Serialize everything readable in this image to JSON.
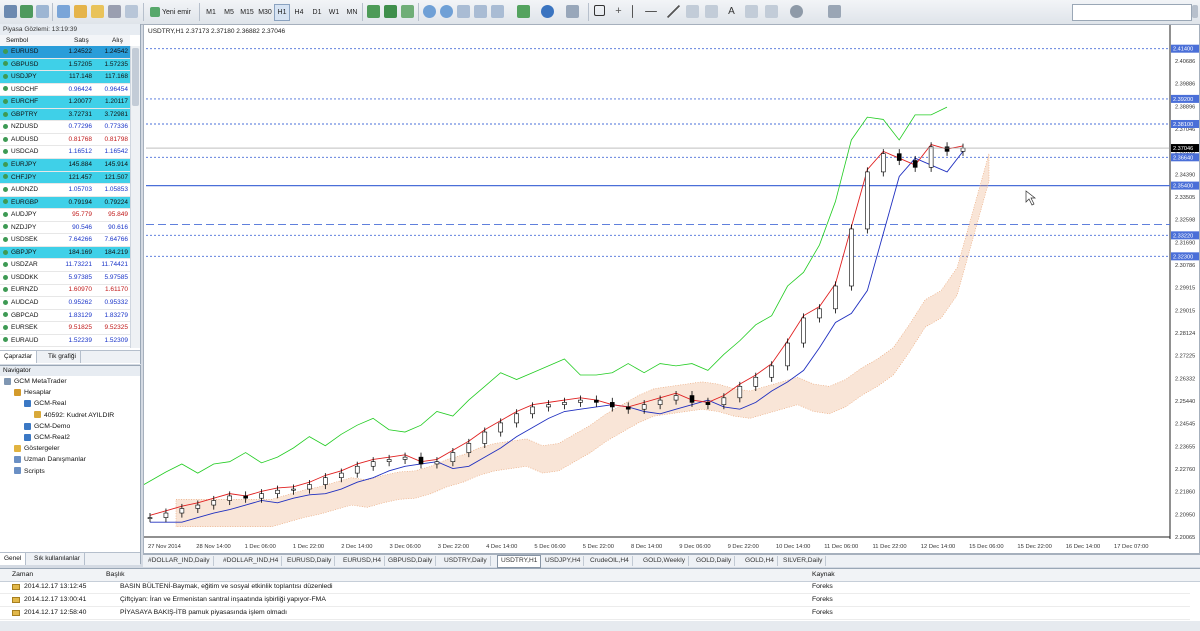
{
  "toolbar": {
    "new_order_label": "Yeni emir",
    "timeframes": [
      "M1",
      "M5",
      "M15",
      "M30",
      "H1",
      "H4",
      "D1",
      "W1",
      "MN"
    ]
  },
  "market_watch": {
    "title": "Piyasa Gözlemi: 13:19:39",
    "col_symbol": "Sembol",
    "col_bid": "Satış",
    "col_ask": "Alış",
    "rows": [
      {
        "symbol": "EURUSD",
        "bid": "1.24522",
        "ask": "1.24542",
        "hl": "#2a9dd9"
      },
      {
        "symbol": "GBPUSD",
        "bid": "1.57205",
        "ask": "1.57235",
        "hl": "#3fd0e8"
      },
      {
        "symbol": "USDJPY",
        "bid": "117.148",
        "ask": "117.168",
        "hl": "#3fd0e8"
      },
      {
        "symbol": "USDCHF",
        "bid": "0.96424",
        "ask": "0.96454",
        "hl": ""
      },
      {
        "symbol": "EURCHF",
        "bid": "1.20077",
        "ask": "1.20117",
        "hl": "#3fd0e8"
      },
      {
        "symbol": "GBPTRY",
        "bid": "3.72731",
        "ask": "3.72981",
        "hl": "#3fd0e8"
      },
      {
        "symbol": "NZDUSD",
        "bid": "0.77296",
        "ask": "0.77336",
        "hl": ""
      },
      {
        "symbol": "AUDUSD",
        "bid": "0.81768",
        "ask": "0.81798",
        "hl": ""
      },
      {
        "symbol": "USDCAD",
        "bid": "1.16512",
        "ask": "1.16542",
        "hl": ""
      },
      {
        "symbol": "EURJPY",
        "bid": "145.884",
        "ask": "145.914",
        "hl": "#3fd0e8"
      },
      {
        "symbol": "CHFJPY",
        "bid": "121.457",
        "ask": "121.507",
        "hl": "#3fd0e8"
      },
      {
        "symbol": "AUDNZD",
        "bid": "1.05703",
        "ask": "1.05853",
        "hl": ""
      },
      {
        "symbol": "EURGBP",
        "bid": "0.79194",
        "ask": "0.79224",
        "hl": "#3fd0e8"
      },
      {
        "symbol": "AUDJPY",
        "bid": "95.779",
        "ask": "95.849",
        "hl": ""
      },
      {
        "symbol": "NZDJPY",
        "bid": "90.546",
        "ask": "90.616",
        "hl": ""
      },
      {
        "symbol": "USDSEK",
        "bid": "7.64266",
        "ask": "7.64766",
        "hl": ""
      },
      {
        "symbol": "GBPJPY",
        "bid": "184.169",
        "ask": "184.219",
        "hl": "#3fd0e8"
      },
      {
        "symbol": "USDZAR",
        "bid": "11.73221",
        "ask": "11.74421",
        "hl": ""
      },
      {
        "symbol": "USDDKK",
        "bid": "5.97385",
        "ask": "5.97585",
        "hl": ""
      },
      {
        "symbol": "EURNZD",
        "bid": "1.60970",
        "ask": "1.61170",
        "hl": ""
      },
      {
        "symbol": "AUDCAD",
        "bid": "0.95262",
        "ask": "0.95332",
        "hl": ""
      },
      {
        "symbol": "GBPCAD",
        "bid": "1.83129",
        "ask": "1.83279",
        "hl": ""
      },
      {
        "symbol": "EURSEK",
        "bid": "9.51825",
        "ask": "9.52325",
        "hl": ""
      },
      {
        "symbol": "EURAUD",
        "bid": "1.52239",
        "ask": "1.52309",
        "hl": ""
      }
    ],
    "tabs": [
      "Çaprazlar",
      "Tik grafiği"
    ]
  },
  "navigator": {
    "title": "Navigator",
    "items": [
      {
        "label": "GCM MetaTrader",
        "indent": 0,
        "icon": "#7f96b2"
      },
      {
        "label": "Hesaplar",
        "indent": 1,
        "icon": "#d39a2b"
      },
      {
        "label": "GCM-Real",
        "indent": 2,
        "icon": "#3b78c4"
      },
      {
        "label": "40592: Kudret AYILDIR",
        "indent": 3,
        "icon": "#d8a93a"
      },
      {
        "label": "GCM-Demo",
        "indent": 2,
        "icon": "#3b78c4"
      },
      {
        "label": "GCM-Real2",
        "indent": 2,
        "icon": "#3b78c4"
      },
      {
        "label": "Göstergeler",
        "indent": 1,
        "icon": "#e1b340"
      },
      {
        "label": "Uzman Danışmanlar",
        "indent": 1,
        "icon": "#6a8fc4"
      },
      {
        "label": "Scripts",
        "indent": 1,
        "icon": "#6a8fc4"
      }
    ],
    "tabs": [
      "Genel",
      "Sık kullanılanlar"
    ]
  },
  "chart": {
    "header": "USDTRY,H1  2.37173 2.37180 2.36882 2.37046",
    "colors": {
      "candle": "#000000",
      "tenkan": "#e02020",
      "kijun": "#2030c0",
      "chikou": "#22cc22",
      "cloud": "#e8a070",
      "hline": "#4a6fd8"
    }
  },
  "chart_data": {
    "type": "line",
    "title": "USDTRY,H1  2.37173 2.37180 2.36882 2.37046",
    "ylim": [
      2.2,
      2.42
    ],
    "yticks": [
      "2.40686",
      "2.39886",
      "2.38896",
      "2.37046",
      "2.36165",
      "2.34390",
      "2.33505",
      "2.32598",
      "2.31690",
      "2.30786",
      "2.29915",
      "2.29015",
      "2.28124",
      "2.27225",
      "2.26332",
      "2.25440",
      "2.24545",
      "2.23655",
      "2.22760",
      "2.21860",
      "2.20950",
      "2.20065"
    ],
    "xticks": [
      "27 Nov 2014",
      "28 Nov 14:00",
      "1 Dec 06:00",
      "1 Dec 22:00",
      "2 Dec 14:00",
      "3 Dec 06:00",
      "3 Dec 22:00",
      "4 Dec 14:00",
      "5 Dec 06:00",
      "5 Dec 22:00",
      "8 Dec 14:00",
      "9 Dec 06:00",
      "9 Dec 22:00",
      "10 Dec 14:00",
      "11 Dec 06:00",
      "11 Dec 22:00",
      "12 Dec 14:00",
      "15 Dec 06:00",
      "15 Dec 22:00",
      "16 Dec 14:00",
      "17 Dec 07:00"
    ],
    "price_levels": [
      {
        "value": 2.414,
        "label": "2.41400",
        "style": "dotted"
      },
      {
        "value": 2.392,
        "label": "2.39200",
        "style": "dotted"
      },
      {
        "value": 2.381,
        "label": "2.38100",
        "style": "dotted"
      },
      {
        "value": 2.3664,
        "label": "2.36640",
        "style": "dotted"
      },
      {
        "value": 2.354,
        "label": "2.35400",
        "style": "solid"
      },
      {
        "value": 2.337,
        "label": "",
        "style": "dashed"
      },
      {
        "value": 2.3322,
        "label": "2.33220",
        "style": "dotted"
      },
      {
        "value": 2.323,
        "label": "2.32300",
        "style": "dotted"
      }
    ],
    "current_price": "2.37046",
    "series": [
      {
        "kind": "close",
        "values": [
          2.2085,
          2.2105,
          2.2125,
          2.214,
          2.216,
          2.218,
          2.217,
          2.219,
          2.2205,
          2.221,
          2.223,
          2.226,
          2.228,
          2.231,
          2.233,
          2.234,
          2.235,
          2.232,
          2.233,
          2.237,
          2.241,
          2.246,
          2.25,
          2.254,
          2.257,
          2.258,
          2.259,
          2.26,
          2.259,
          2.257,
          2.256,
          2.258,
          2.26,
          2.262,
          2.259,
          2.258,
          2.261,
          2.266,
          2.27,
          2.275,
          2.285,
          2.296,
          2.3,
          2.31,
          2.335,
          2.36,
          2.368,
          2.365,
          2.362,
          2.371,
          2.369,
          2.3704
        ]
      }
    ]
  },
  "chart_tabs": [
    "#DOLLAR_IND,Daily",
    "#DOLLAR_IND,H4",
    "EURUSD,Daily",
    "EURUSD,H4",
    "GBPUSD,Daily",
    "USDTRY,Daily",
    "USDTRY,H1",
    "USDJPY,H4",
    "CrudeOIL,H4",
    "GOLD,Weekly",
    "GOLD,Daily",
    "GOLD,H4",
    "SILVER,Daily"
  ],
  "active_chart_tab": 6,
  "news": {
    "col_time": "Zaman",
    "col_title": "Başlık",
    "col_source": "Kaynak",
    "rows": [
      {
        "time": "2014.12.17 13:12:45",
        "title": "BASIN BÜLTENİ-Baymak, eğitim ve sosyal etkinlik toplantısı düzenledi",
        "source": "Foreks"
      },
      {
        "time": "2014.12.17 13:00:41",
        "title": "Çiftçiyan: İran ve Ermenistan santral inşaatında işbirliği yapıyor-FMA",
        "source": "Foreks"
      },
      {
        "time": "2014.12.17 12:58:40",
        "title": "PİYASAYA BAKIŞ-İTB pamuk piyasasında işlem olmadı",
        "source": "Foreks"
      }
    ]
  }
}
